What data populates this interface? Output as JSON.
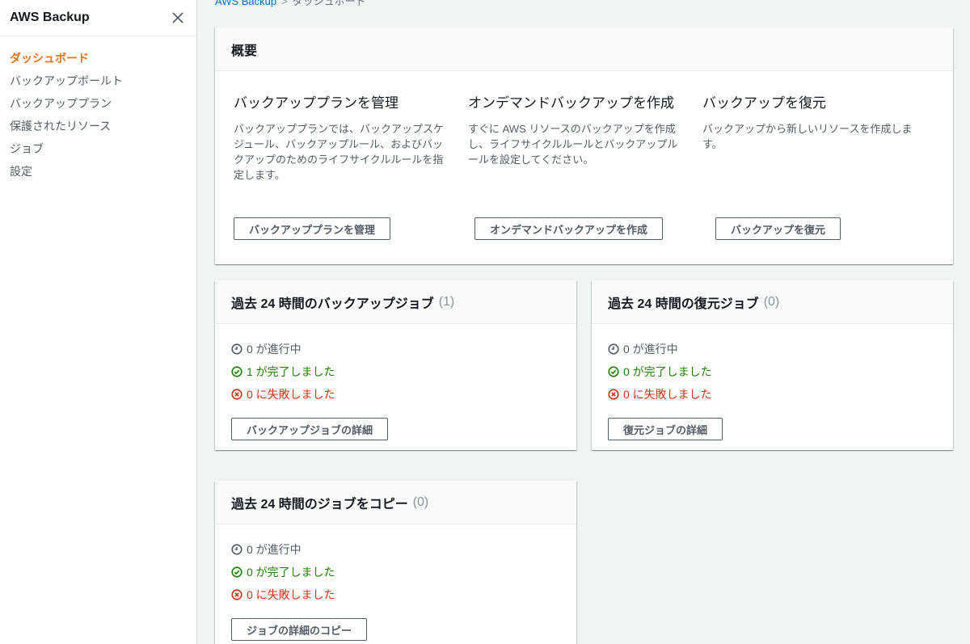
{
  "sidebar": {
    "title": "AWS Backup",
    "items": [
      {
        "label": "ダッシュボード",
        "active": true
      },
      {
        "label": "バックアップボールト"
      },
      {
        "label": "バックアッププラン"
      },
      {
        "label": "保護されたリソース"
      },
      {
        "label": "ジョブ"
      },
      {
        "label": "設定"
      }
    ]
  },
  "breadcrumb": {
    "root": "AWS Backup",
    "separator": ">",
    "current": "ダッシュボード"
  },
  "overview": {
    "title": "概要",
    "columns": [
      {
        "heading": "バックアッププランを管理",
        "description": "バックアッププランでは、バックアップスケジュール、バックアップルール、およびバックアップのためのライフサイクルルールを指定します。",
        "button": "バックアッププランを管理"
      },
      {
        "heading": "オンデマンドバックアップを作成",
        "description": "すぐに AWS リソースのバックアップを作成し、ライフサイクルルールとバックアップルールを設定してください。",
        "button": "オンデマンドバックアップを作成"
      },
      {
        "heading": "バックアップを復元",
        "description": "バックアップから新しいリソースを作成します。",
        "button": "バックアップを復元"
      }
    ]
  },
  "backup_jobs": {
    "title": "過去 24 時間のバックアップジョブ",
    "count": "(1)",
    "in_progress": "0 が進行中",
    "completed": "1 が完了しました",
    "failed": "0 に失敗しました",
    "button": "バックアップジョブの詳細"
  },
  "restore_jobs": {
    "title": "過去 24 時間の復元ジョブ",
    "count": "(0)",
    "in_progress": "0 が進行中",
    "completed": "0 が完了しました",
    "failed": "0 に失敗しました",
    "button": "復元ジョブの詳細"
  },
  "copy_jobs": {
    "title": "過去 24 時間のジョブをコピー",
    "count": "(0)",
    "in_progress": "0 が進行中",
    "completed": "0 が完了しました",
    "failed": "0 に失敗しました",
    "button": "ジョブの詳細のコピー"
  },
  "colors": {
    "accent": "#ec7211",
    "success": "#1d8102",
    "error": "#d13212",
    "link": "#0073bb"
  },
  "icons": {
    "close": "close-icon",
    "in_progress": "clock-icon",
    "completed": "check-circle-icon",
    "failed": "x-circle-icon"
  }
}
